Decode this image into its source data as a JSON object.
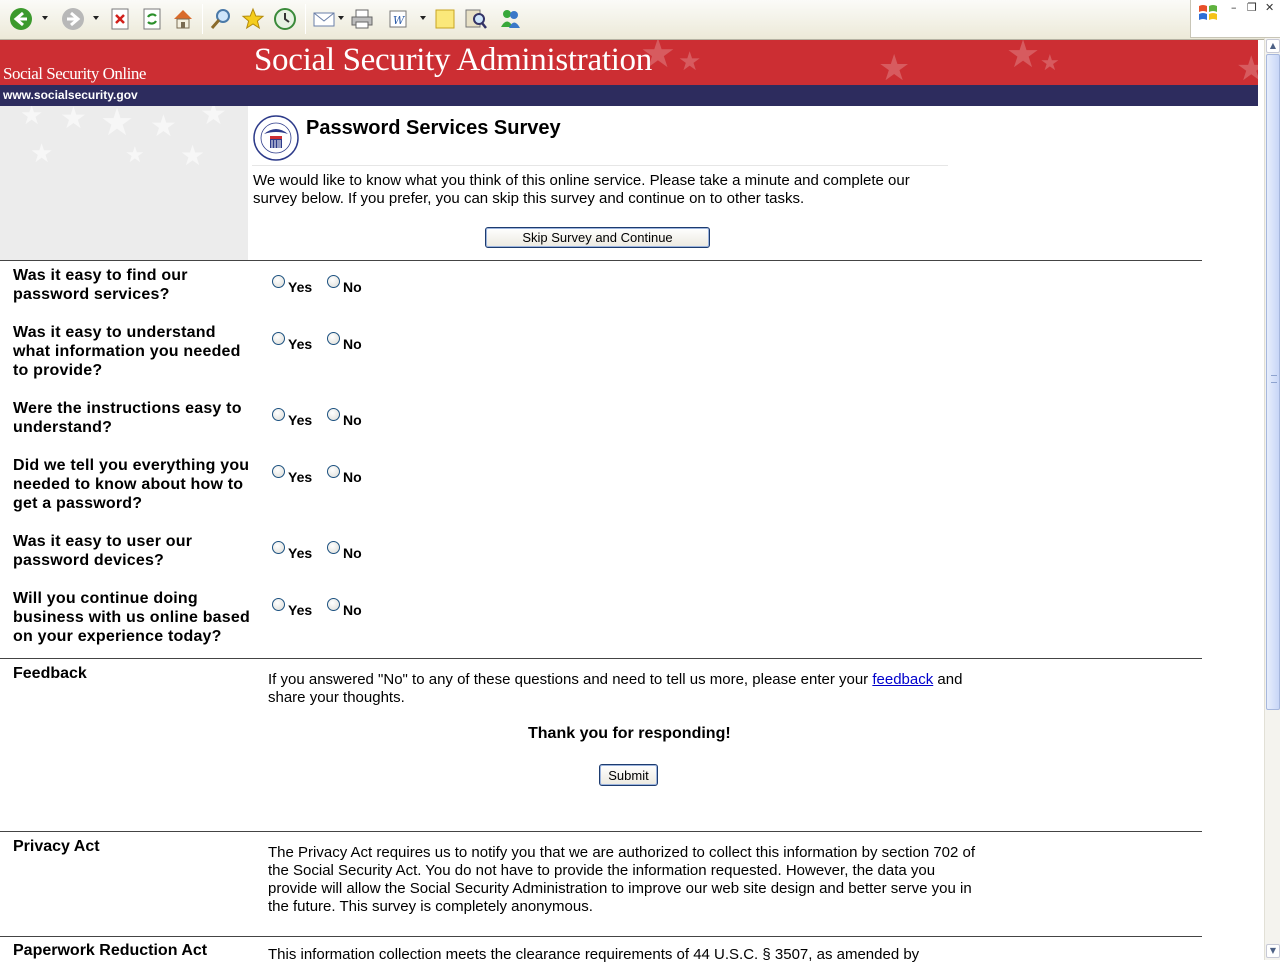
{
  "browser": {
    "toolbar_icons": [
      "back-icon",
      "forward-icon",
      "stop-icon",
      "refresh-icon",
      "home-icon",
      "search-icon",
      "favorites-icon",
      "history-icon",
      "mail-icon",
      "print-icon",
      "edit-icon",
      "note-icon",
      "research-icon",
      "messenger-icon"
    ]
  },
  "header": {
    "site_name": "Social Security Online",
    "agency_name": "Social Security Administration",
    "url": "www.socialsecurity.gov",
    "colors": {
      "red": "#cc2e33",
      "navy": "#2d2c5e"
    }
  },
  "intro": {
    "title": "Password Services Survey",
    "text": "We would like to know what you think of this online service. Please take a minute and complete our survey below. If you prefer, you can skip this survey and continue on to other tasks.",
    "skip_button": "Skip Survey and Continue"
  },
  "survey": {
    "yes_label": "Yes",
    "no_label": "No",
    "questions": [
      "Was it easy to find our password services?",
      "Was it easy to understand what information you needed to provide?",
      "Were the instructions easy to understand?",
      "Did we tell you everything you needed to know about how to get a password?",
      "Was it easy to user our password devices?",
      "Will you continue doing business with us online based on your experience today?"
    ]
  },
  "feedback": {
    "label": "Feedback",
    "text_before": "If you answered \"No\" to any of these questions and need to tell us more, please enter your ",
    "link": "feedback",
    "text_after": " and share your thoughts.",
    "thanks": "Thank you for responding!",
    "submit": "Submit"
  },
  "privacy": {
    "label": "Privacy Act",
    "text": "The Privacy Act requires us to notify you that we are authorized to collect this information by section 702 of the Social Security Act. You do not have to provide the information requested. However, the data you provide will allow the Social Security Administration to improve our web site design and better serve you in the future. This survey is completely anonymous."
  },
  "paperwork": {
    "label": "Paperwork Reduction Act",
    "text": "This information collection meets the clearance requirements of 44 U.S.C. § 3507, as amended by"
  }
}
